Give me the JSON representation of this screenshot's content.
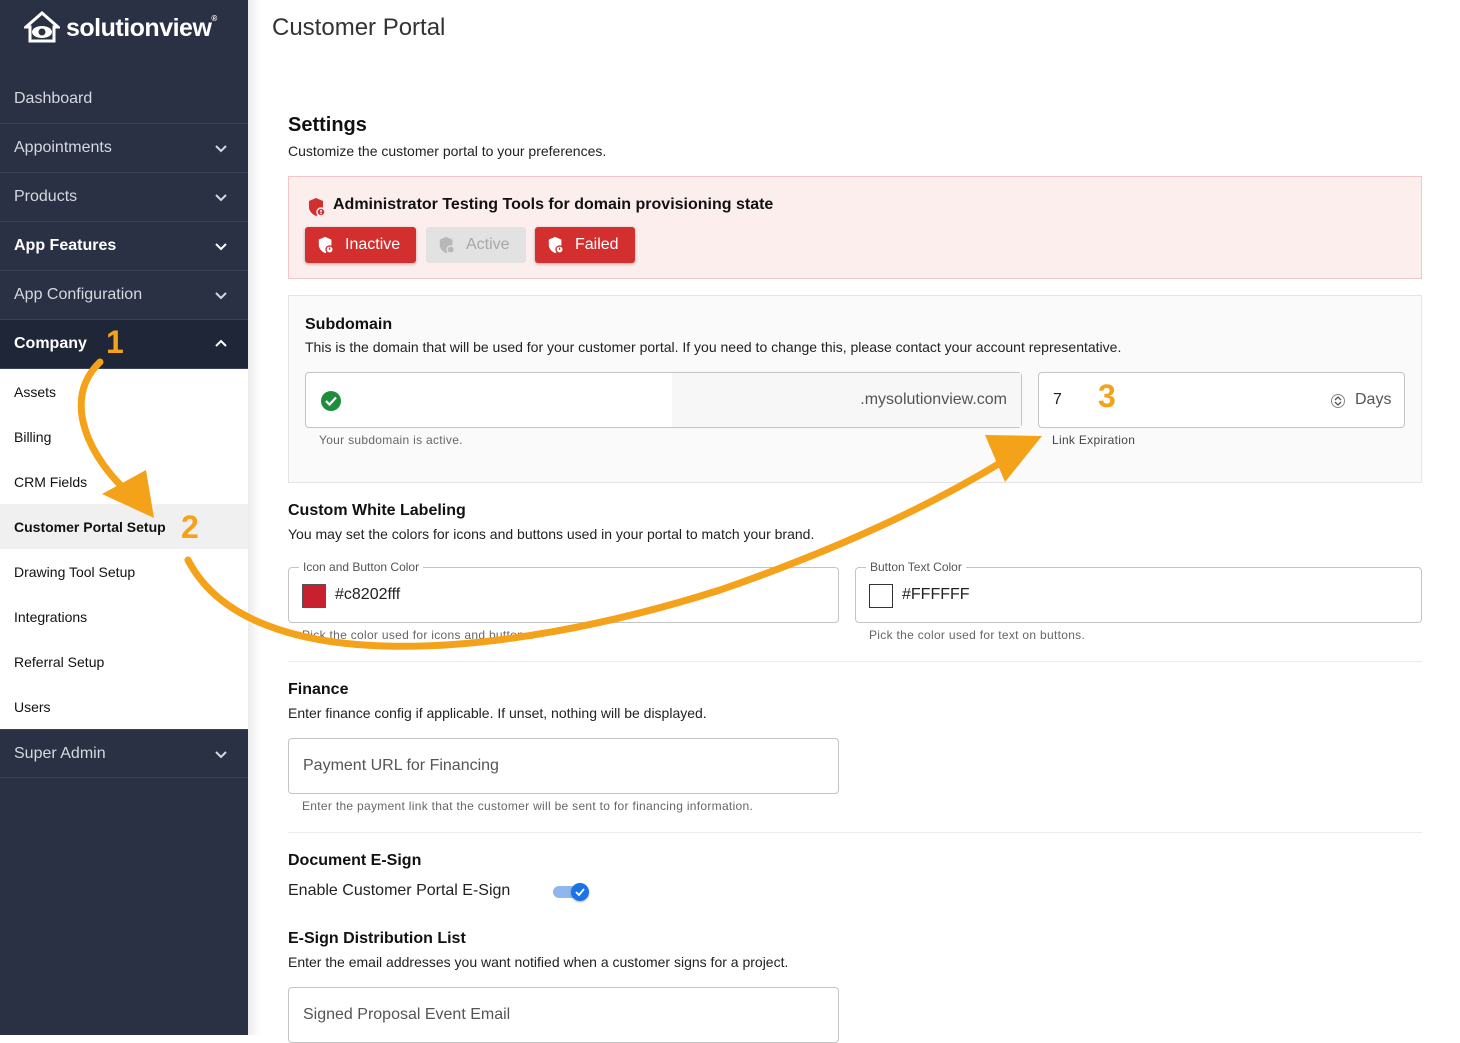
{
  "brand": {
    "name": "solutionview",
    "reg": "®"
  },
  "sidebar": {
    "items": [
      {
        "label": "Dashboard"
      },
      {
        "label": "Appointments"
      },
      {
        "label": "Products"
      },
      {
        "label": "App Features"
      },
      {
        "label": "App Configuration"
      },
      {
        "label": "Company"
      },
      {
        "label": "Super Admin"
      }
    ],
    "company_sub": [
      {
        "label": "Assets"
      },
      {
        "label": "Billing"
      },
      {
        "label": "CRM Fields"
      },
      {
        "label": "Customer Portal Setup"
      },
      {
        "label": "Drawing Tool Setup"
      },
      {
        "label": "Integrations"
      },
      {
        "label": "Referral Setup"
      },
      {
        "label": "Users"
      }
    ]
  },
  "page": {
    "title": "Customer Portal"
  },
  "settings": {
    "title": "Settings",
    "description": "Customize the customer portal to your preferences."
  },
  "admin_tools": {
    "title": "Administrator Testing Tools for domain provisioning state",
    "buttons": [
      {
        "label": "Inactive"
      },
      {
        "label": "Active"
      },
      {
        "label": "Failed"
      }
    ]
  },
  "subdomain": {
    "title": "Subdomain",
    "description": "This is the domain that will be used for your customer portal. If you need to change this, please contact your account representative.",
    "suffix": ".mysolutionview.com",
    "helper": "Your subdomain is active.",
    "expiration_value": "7",
    "expiration_unit": "Days",
    "expiration_label": "Link Expiration"
  },
  "white_label": {
    "title": "Custom White Labeling",
    "description": "You may set the colors for icons and buttons used in your portal to match your brand.",
    "icon_color_label": "Icon and Button Color",
    "icon_color_value": "#c8202fff",
    "icon_color_helper": "Pick the color used for icons and buttons.",
    "text_color_label": "Button Text Color",
    "text_color_value": "#FFFFFF",
    "text_color_helper": "Pick the color used for text on buttons.",
    "icon_swatch": "#c8202f",
    "text_swatch": "#ffffff"
  },
  "finance": {
    "title": "Finance",
    "description": "Enter finance config if applicable. If unset, nothing will be displayed.",
    "placeholder": "Payment URL for Financing",
    "helper": "Enter the payment link that the customer will be sent to for financing information."
  },
  "esign": {
    "title": "Document E-Sign",
    "toggle_label": "Enable Customer Portal E-Sign",
    "enabled": true
  },
  "distribution": {
    "title": "E-Sign Distribution List",
    "description": "Enter the email addresses you want notified when a customer signs for a project.",
    "placeholder": "Signed Proposal Event Email"
  },
  "annotations": {
    "step1": "1",
    "step2": "2",
    "step3": "3"
  },
  "colors": {
    "accent": "#d32f2f",
    "sidebar": "#2a3145",
    "annotation": "#f4a21a",
    "success": "#1e8e3e",
    "toggle": "#1a73e8"
  }
}
